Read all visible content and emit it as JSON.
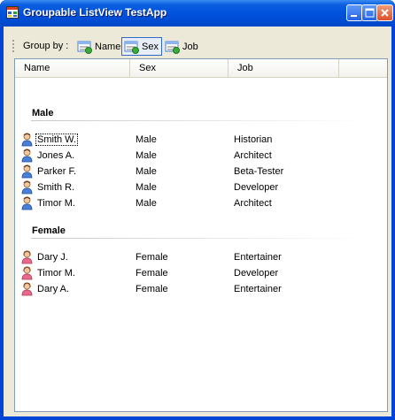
{
  "window": {
    "title": "Groupable ListView TestApp"
  },
  "toolbar": {
    "label": "Group by :",
    "buttons": [
      {
        "label": "Name",
        "checked": false
      },
      {
        "label": "Sex",
        "checked": true
      },
      {
        "label": "Job",
        "checked": false
      }
    ]
  },
  "columns": [
    "Name",
    "Sex",
    "Job"
  ],
  "groups": [
    {
      "title": "Male",
      "items": [
        {
          "name": "Smith W.",
          "sex": "Male",
          "job": "Historian",
          "icon": "male-user-icon",
          "focused": true
        },
        {
          "name": "Jones A.",
          "sex": "Male",
          "job": "Architect",
          "icon": "male-user-icon"
        },
        {
          "name": "Parker F.",
          "sex": "Male",
          "job": "Beta-Tester",
          "icon": "male-user-icon"
        },
        {
          "name": "Smith R.",
          "sex": "Male",
          "job": "Developer",
          "icon": "male-user-icon"
        },
        {
          "name": "Timor M.",
          "sex": "Male",
          "job": "Architect",
          "icon": "male-user-icon"
        }
      ]
    },
    {
      "title": "Female",
      "items": [
        {
          "name": "Dary J.",
          "sex": "Female",
          "job": "Entertainer",
          "icon": "female-user-icon"
        },
        {
          "name": "Timor M.",
          "sex": "Female",
          "job": "Developer",
          "icon": "female-user-icon"
        },
        {
          "name": "Dary A.",
          "sex": "Female",
          "job": "Entertainer",
          "icon": "female-user-icon"
        }
      ]
    }
  ],
  "colors": {
    "titlebar": "#0050DC",
    "frame": "#0045D6",
    "client": "#ECE9D8",
    "male_icon": "#4A7FD8",
    "female_icon": "#E86A8A"
  }
}
